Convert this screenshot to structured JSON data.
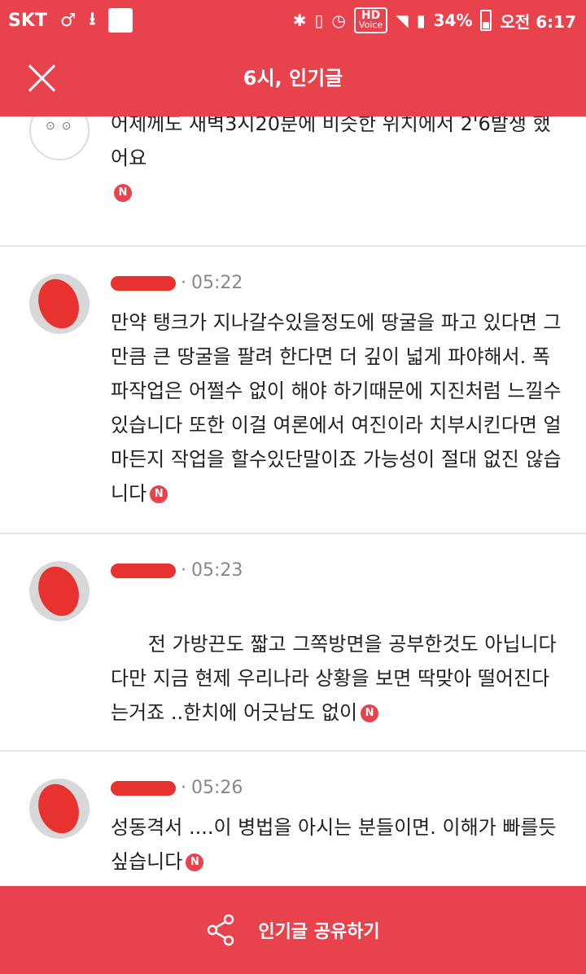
{
  "status_bar": {
    "carrier": "SKT",
    "hd_label": "HD",
    "voice_label": "Voice",
    "battery": "34%",
    "time": "오전 6:17"
  },
  "header": {
    "title": "6시, 인기글"
  },
  "comments": [
    {
      "time": "",
      "text": "어제께도 새벽3시20분에 비슷한 위치에서 2'6발생 했어요"
    },
    {
      "time": "05:22",
      "text": "만약 탱크가 지나갈수있을정도에 땅굴을 파고 있다면 그만큼 큰 땅굴을 팔려 한다면 더 깊이 넓게 파야해서. 폭파작업은 어쩔수 없이 해야 하기때문에 지진처럼 느낄수 있습니다 또한 이걸 여론에서 여진이라 치부시킨다면 얼마든지 작업을 할수있단말이죠 가능성이 절대 없진 않습니다"
    },
    {
      "time": "05:23",
      "text": "전 가방끈도 짧고 그쪽방면을 공부한것도 아닙니다\n다만 지금 현제 우리나라 상황을 보면 딱맞아 떨어진다는거죠 ..한치에 어긋남도 없이"
    },
    {
      "time": "05:26",
      "text": "성동격서 ....이 병법을 아시는 분들이면. 이해가 빠를듯 싶습니다"
    }
  ],
  "badge_label": "N",
  "bottom_bar": {
    "share_label": "인기글 공유하기"
  },
  "colors": {
    "accent": "#e8434d"
  }
}
